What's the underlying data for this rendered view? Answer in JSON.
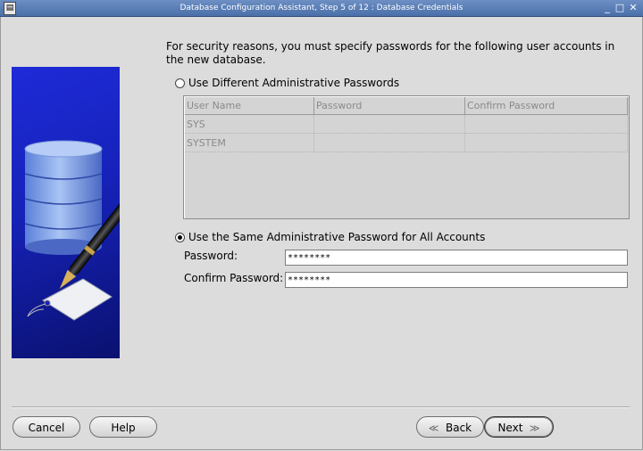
{
  "window": {
    "title": "Database Configuration Assistant, Step 5 of 12 : Database Credentials",
    "controls": {
      "minimize": "_",
      "maximize": "□",
      "close": "✕"
    }
  },
  "intro_text": "For security reasons, you must specify passwords for the following user accounts in the new database.",
  "options": {
    "different": {
      "label": "Use Different Administrative Passwords",
      "selected": false
    },
    "same": {
      "label": "Use the Same Administrative Password for All Accounts",
      "selected": true
    }
  },
  "table": {
    "headers": [
      "User Name",
      "Password",
      "Confirm Password"
    ],
    "rows": [
      {
        "user": "SYS",
        "password": "",
        "confirm": ""
      },
      {
        "user": "SYSTEM",
        "password": "",
        "confirm": ""
      }
    ]
  },
  "password": {
    "label": "Password:",
    "value": "********"
  },
  "confirm_password": {
    "label": "Confirm Password:",
    "value": "********"
  },
  "buttons": {
    "cancel": "Cancel",
    "help": "Help",
    "back": "Back",
    "next": "Next"
  },
  "colors": {
    "titlebar": "#4a6fa8",
    "side_panel": "#1622b8",
    "background": "#dcdcdc"
  }
}
